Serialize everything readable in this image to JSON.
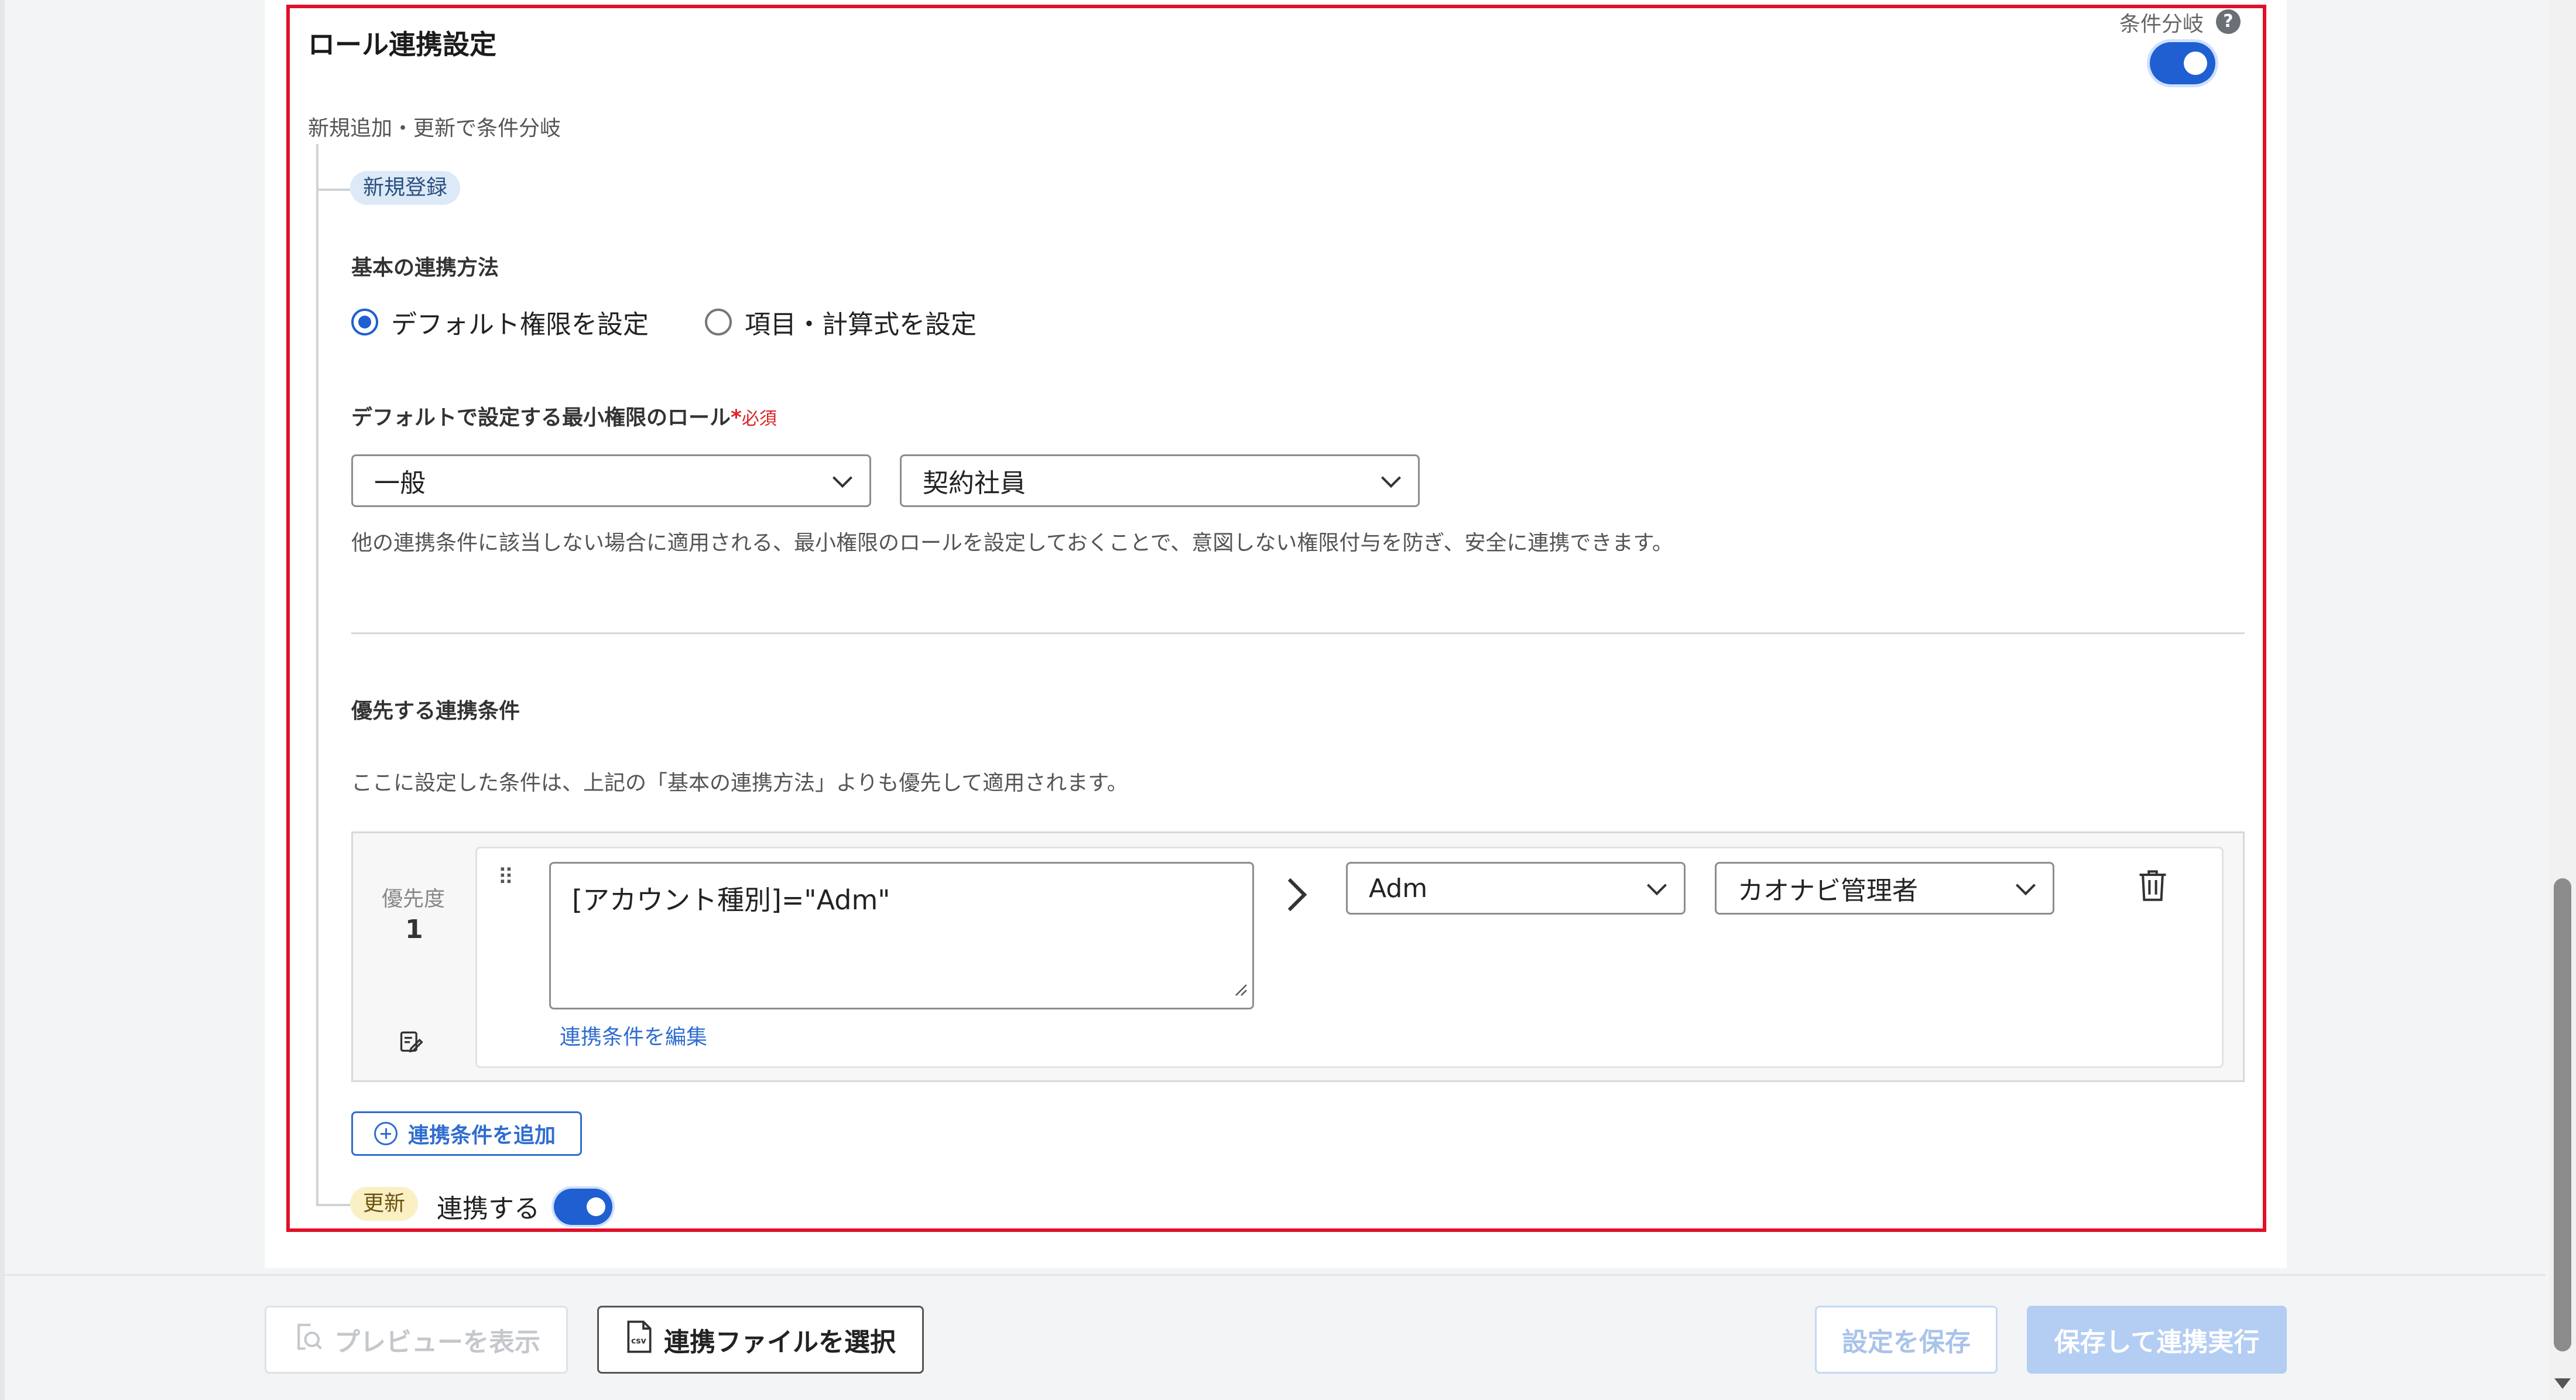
{
  "panel": {
    "title": "ロール連携設定",
    "condition_branch_label": "条件分岐",
    "condition_branch_enabled": true,
    "help_icon": "question-circle-icon",
    "subtitle": "新規追加・更新で条件分岐"
  },
  "new_registration": {
    "badge": "新規登録",
    "basic_method_label": "基本の連携方法",
    "radio_options": [
      {
        "label": "デフォルト権限を設定",
        "checked": true
      },
      {
        "label": "項目・計算式を設定",
        "checked": false
      }
    ],
    "default_role_label": "デフォルトで設定する最小権限のロール",
    "required_star": "*",
    "required_text": "必須",
    "role_select_1": "一般",
    "role_select_2": "契約社員",
    "default_help": "他の連携条件に該当しない場合に適用される、最小権限のロールを設定しておくことで、意図しない権限付与を防ぎ、安全に連携できます。",
    "priority_section_label": "優先する連携条件",
    "priority_help": "ここに設定した条件は、上記の「基本の連携方法」よりも優先して適用されます。",
    "conditions": [
      {
        "priority_label": "優先度",
        "priority": "1",
        "formula": "[アカウント種別]=\"Adm\"",
        "edit_link": "連携条件を編集",
        "value_select": "Adm",
        "role_select": "カオナビ管理者"
      }
    ],
    "add_condition_button": "連携条件を追加"
  },
  "update": {
    "badge": "更新",
    "label": "連携する",
    "enabled": true
  },
  "footer": {
    "preview_button": "プレビューを表示",
    "file_button": "連携ファイルを選択",
    "save_button": "設定を保存",
    "save_run_button": "保存して連携実行"
  },
  "colors": {
    "accent": "#1f5fd1",
    "highlight_border": "#e0102a",
    "link": "#2f6dd0"
  }
}
